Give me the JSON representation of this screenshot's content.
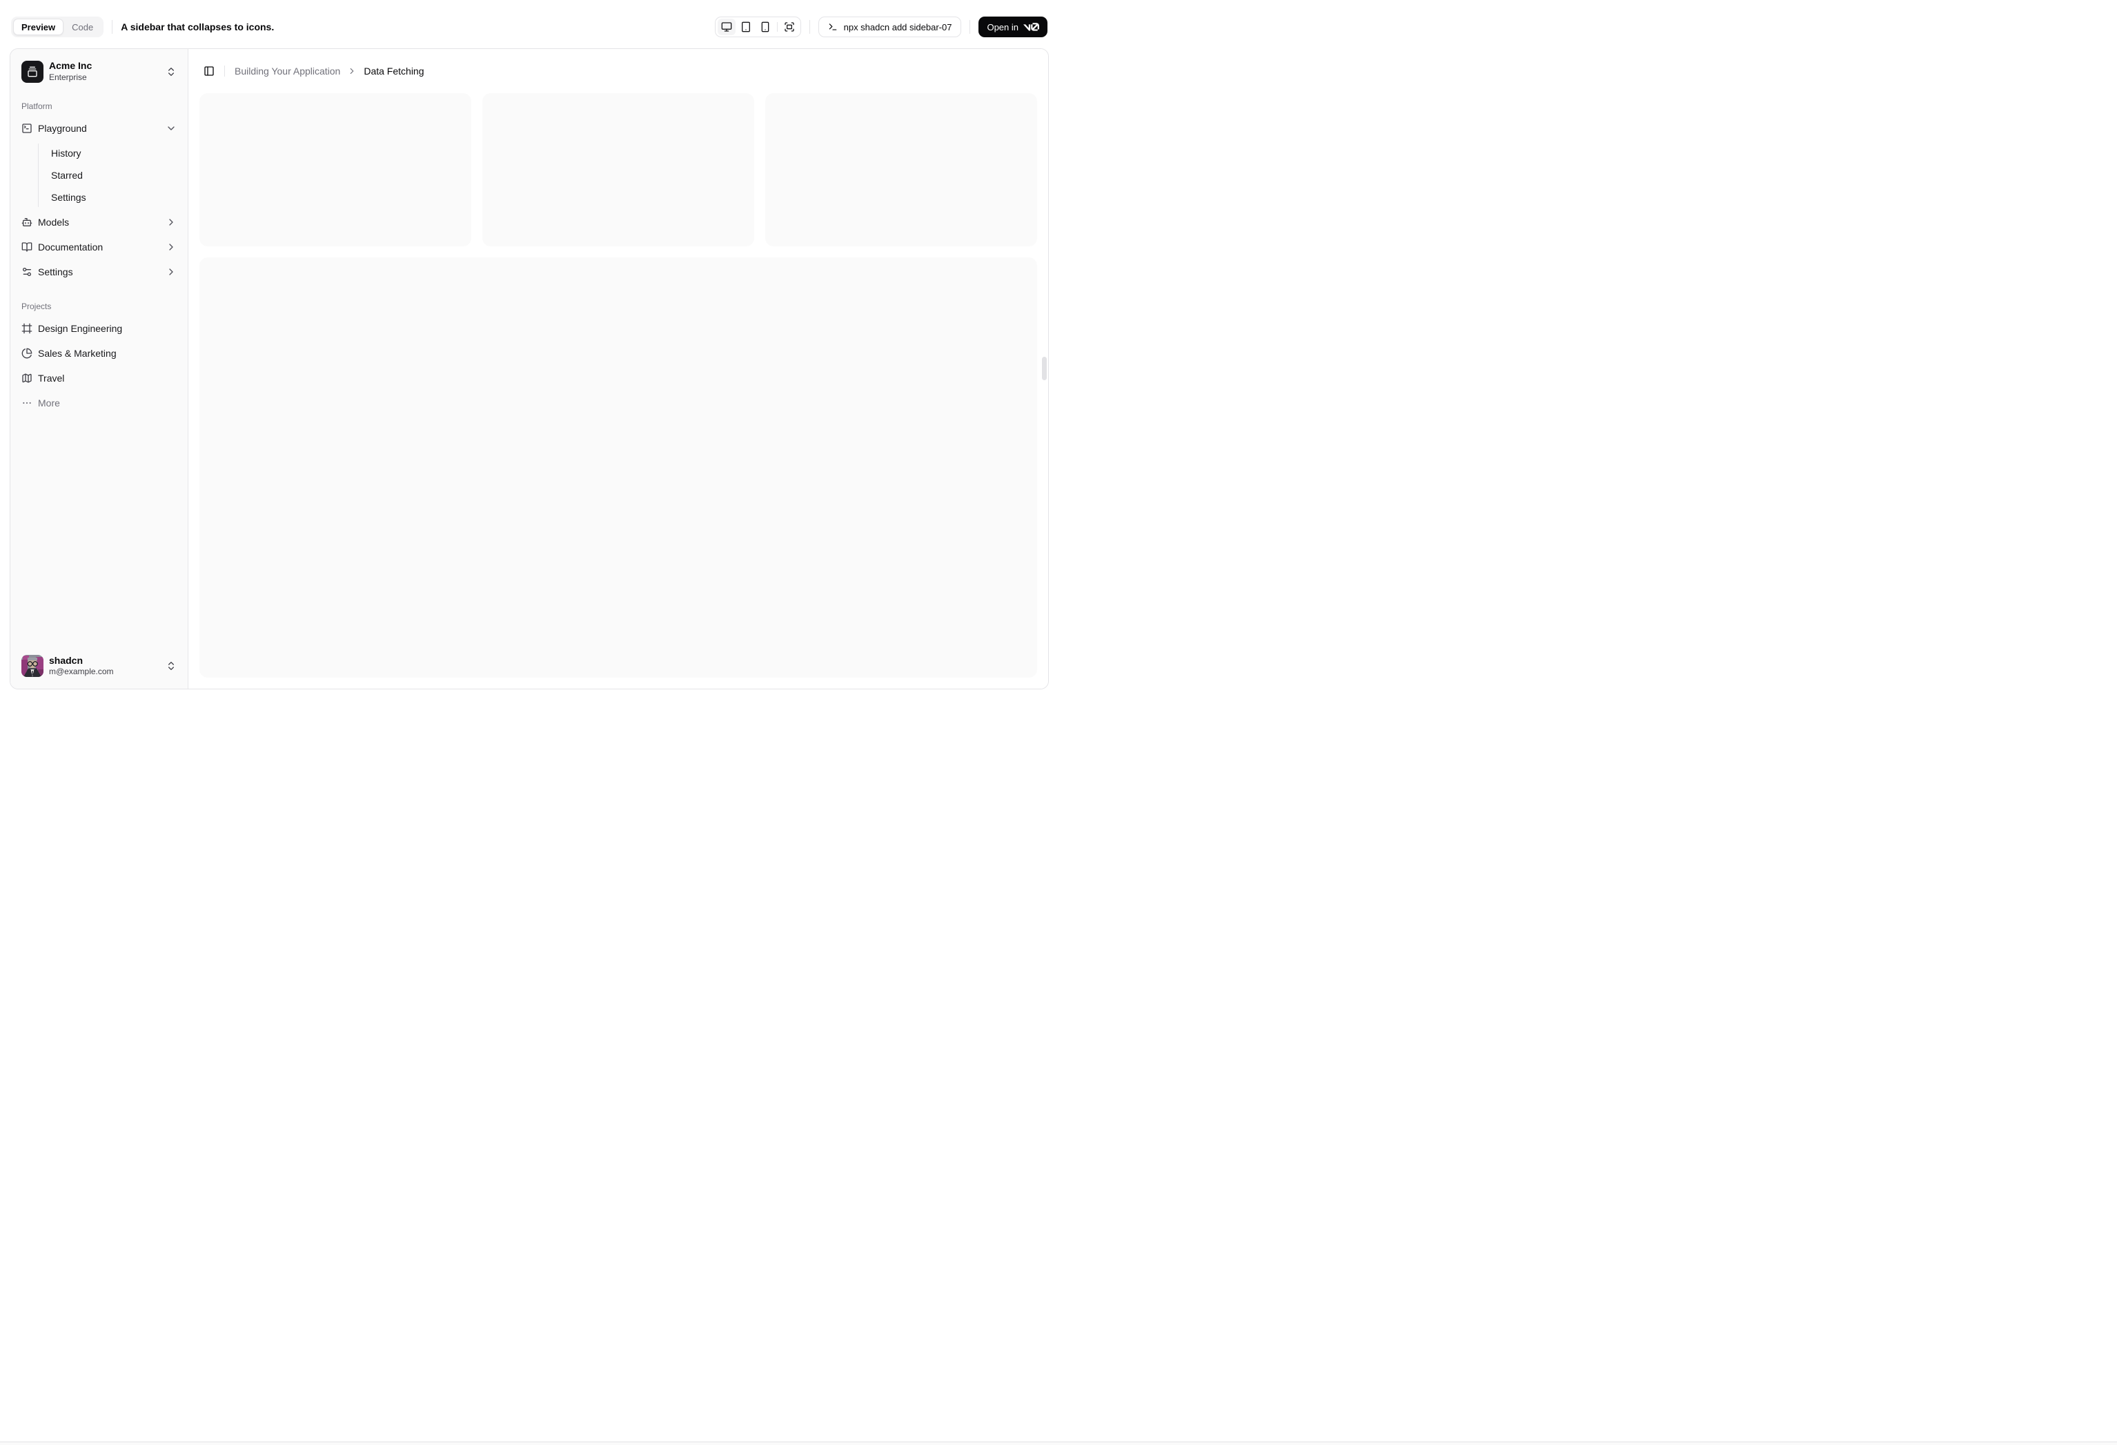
{
  "toolbar": {
    "tabs": [
      {
        "label": "Preview"
      },
      {
        "label": "Code"
      }
    ],
    "description": "A sidebar that collapses to icons.",
    "devices": [
      {
        "icon": "monitor-icon",
        "active": true
      },
      {
        "icon": "tablet-icon",
        "active": false
      },
      {
        "icon": "smartphone-icon",
        "active": false
      },
      {
        "icon": "fullscreen-icon",
        "active": false
      }
    ],
    "command": "npx shadcn add sidebar-07",
    "open_in": {
      "label": "Open in",
      "brand": "v0"
    }
  },
  "sidebar": {
    "team": {
      "name": "Acme Inc",
      "plan": "Enterprise",
      "icon": "gallery-vertical-end-icon"
    },
    "groups": [
      {
        "label": "Platform",
        "items": [
          {
            "label": "Playground",
            "icon": "square-terminal-icon",
            "expanded": true,
            "children": [
              "History",
              "Starred",
              "Settings"
            ]
          },
          {
            "label": "Models",
            "icon": "bot-icon"
          },
          {
            "label": "Documentation",
            "icon": "book-open-icon"
          },
          {
            "label": "Settings",
            "icon": "settings-icon"
          }
        ]
      },
      {
        "label": "Projects",
        "items": [
          {
            "label": "Design Engineering",
            "icon": "frame-icon"
          },
          {
            "label": "Sales & Marketing",
            "icon": "pie-chart-icon"
          },
          {
            "label": "Travel",
            "icon": "map-icon"
          },
          {
            "label": "More",
            "icon": "ellipsis-icon"
          }
        ]
      }
    ],
    "user": {
      "name": "shadcn",
      "email": "m@example.com"
    }
  },
  "main": {
    "breadcrumb": {
      "parent": "Building Your Application",
      "current": "Data Fetching"
    },
    "placeholders": {
      "top_cards": 3,
      "large_cards": 1
    }
  },
  "colors": {
    "accent": "#09090b",
    "border": "#e4e4e7",
    "muted_bg": "#fafafa",
    "text_muted": "#71717a"
  }
}
